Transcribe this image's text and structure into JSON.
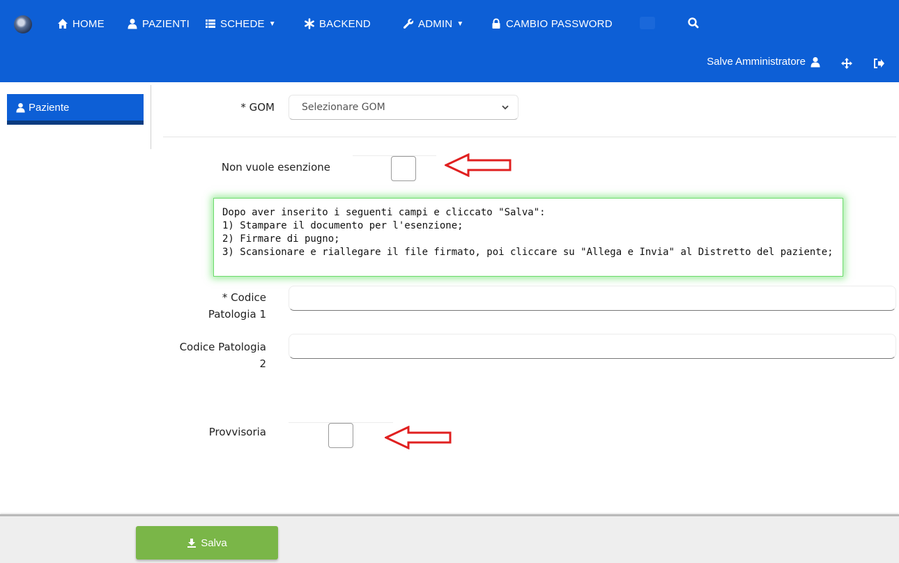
{
  "navbar": {
    "items": [
      {
        "label": "HOME",
        "icon": "home-icon"
      },
      {
        "label": "PAZIENTI",
        "icon": "user-icon"
      },
      {
        "label": "SCHEDE",
        "icon": "list-icon",
        "dropdown": true
      },
      {
        "label": "BACKEND",
        "icon": "asterisk-icon"
      },
      {
        "label": "ADMIN",
        "icon": "wrench-icon",
        "dropdown": true
      },
      {
        "label": "CAMBIO PASSWORD",
        "icon": "lock-icon"
      }
    ],
    "greeting": "Salve Amministratore",
    "colors": {
      "bar": "#0d5fd6",
      "text": "#ffffff"
    }
  },
  "sidebar": {
    "items": [
      {
        "label": "Paziente",
        "icon": "user-icon"
      }
    ]
  },
  "form": {
    "gom": {
      "label": "* GOM",
      "placeholder": "Selezionare GOM"
    },
    "non_vuole_esenzione": {
      "label": "Non vuole esenzione",
      "checked": false
    },
    "info_lines": [
      "Dopo aver inserito i seguenti campi e cliccato \"Salva\":",
      "1) Stampare il documento per l'esenzione;",
      "2) Firmare di pugno;",
      "3) Scansionare e riallegare il file firmato, poi cliccare su \"Allega e Invia\" al Distretto del paziente;"
    ],
    "codice_patologia_1": {
      "label_line1": "* Codice",
      "label_line2": "Patologia 1",
      "value": ""
    },
    "codice_patologia_2": {
      "label_line1": "Codice Patologia",
      "label_line2": "2",
      "value": ""
    },
    "provvisoria": {
      "label": "Provvisoria",
      "checked": false
    }
  },
  "footer": {
    "save_label": "Salva",
    "colors": {
      "save_button": "#7ab648"
    }
  },
  "annotation_color": "#e02020"
}
